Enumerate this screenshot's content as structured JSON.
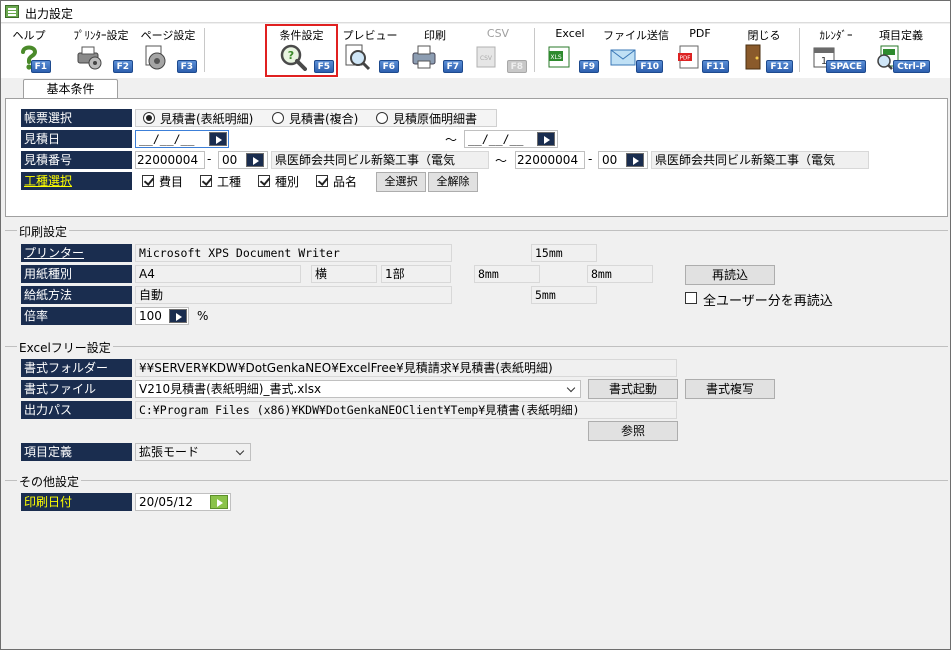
{
  "window": {
    "title": "出力設定"
  },
  "toolbar": {
    "items": [
      {
        "label": "ヘルプ",
        "key": "F1",
        "icon": "help-icon"
      },
      {
        "label": "ﾌﾟﾘﾝﾀｰ設定",
        "key": "F2",
        "icon": "printer-setup-icon"
      },
      {
        "label": "ページ設定",
        "key": "F3",
        "icon": "page-setup-icon"
      },
      {
        "label": "条件設定",
        "key": "F5",
        "icon": "condition-magnifier-icon"
      },
      {
        "label": "プレビュー",
        "key": "F6",
        "icon": "preview-icon"
      },
      {
        "label": "印刷",
        "key": "F7",
        "icon": "print-icon"
      },
      {
        "label": "CSV",
        "key": "F8",
        "icon": "csv-icon"
      },
      {
        "label": "Excel",
        "key": "F9",
        "icon": "excel-icon"
      },
      {
        "label": "ファイル送信",
        "key": "F10",
        "icon": "mail-icon"
      },
      {
        "label": "PDF",
        "key": "F11",
        "icon": "pdf-icon"
      },
      {
        "label": "閉じる",
        "key": "F12",
        "icon": "door-close-icon"
      },
      {
        "label": "ｶﾚﾝﾀﾞｰ",
        "key": "SPACE",
        "icon": "calendar-icon"
      },
      {
        "label": "項目定義",
        "key": "Ctrl-P",
        "icon": "item-definition-icon"
      }
    ]
  },
  "tab": {
    "label": "基本条件"
  },
  "basic": {
    "report_select": {
      "label": "帳票選択",
      "options": [
        "見積書(表紙明細)",
        "見積書(複合)",
        "見積原価明細書"
      ],
      "selected": 0
    },
    "estimate_date": {
      "label": "見積日",
      "from": "__/__/__",
      "tilde": "～",
      "to": "__/__/__"
    },
    "estimate_no": {
      "label": "見積番号",
      "from_no": "22000004",
      "dash": "-",
      "from_sub": "00",
      "from_name": "県医師会共同ビル新築工事（電気",
      "tilde": "～",
      "to_no": "22000004",
      "to_sub": "00",
      "to_name": "県医師会共同ビル新築工事（電気"
    },
    "work_select": {
      "label": "工種選択",
      "checks": [
        "費目",
        "工種",
        "種別",
        "品名"
      ],
      "select_all": "全選択",
      "clear_all": "全解除"
    }
  },
  "print": {
    "title": "印刷設定",
    "printer": {
      "label": "プリンター",
      "value": "Microsoft XPS Document Writer",
      "margin_top": "15mm"
    },
    "paper": {
      "label": "用紙種別",
      "value": "A4",
      "orientation": "横",
      "copies": "1部",
      "margin_left": "8mm",
      "margin_right": "8mm"
    },
    "feed": {
      "label": "給紙方法",
      "value": "自動",
      "margin_bottom": "5mm"
    },
    "scale": {
      "label": "倍率",
      "value": "100",
      "unit": "%"
    },
    "reload_button": "再読込",
    "reload_all_users": "全ユーザー分を再読込"
  },
  "excel": {
    "title": "Excelフリー設定",
    "folder": {
      "label": "書式フォルダー",
      "value": "¥¥SERVER¥KDW¥DotGenkaNEO¥ExcelFree¥見積請求¥見積書(表紙明細)"
    },
    "file": {
      "label": "書式ファイル",
      "value": "V210見積書(表紙明細)_書式.xlsx",
      "launch": "書式起動",
      "copy": "書式複写"
    },
    "output": {
      "label": "出力パス",
      "value": "C:¥Program Files (x86)¥KDW¥DotGenkaNEOClient¥Temp¥見積書(表紙明細)",
      "browse": "参照"
    },
    "item_def": {
      "label": "項目定義",
      "value": "拡張モード"
    }
  },
  "other": {
    "title": "その他設定",
    "print_date": {
      "label": "印刷日付",
      "value": "20/05/12"
    }
  },
  "colors": {
    "label_bg": "#1a2d4f",
    "accent_yellow": "#ffff00",
    "highlight_red": "#e02020"
  }
}
